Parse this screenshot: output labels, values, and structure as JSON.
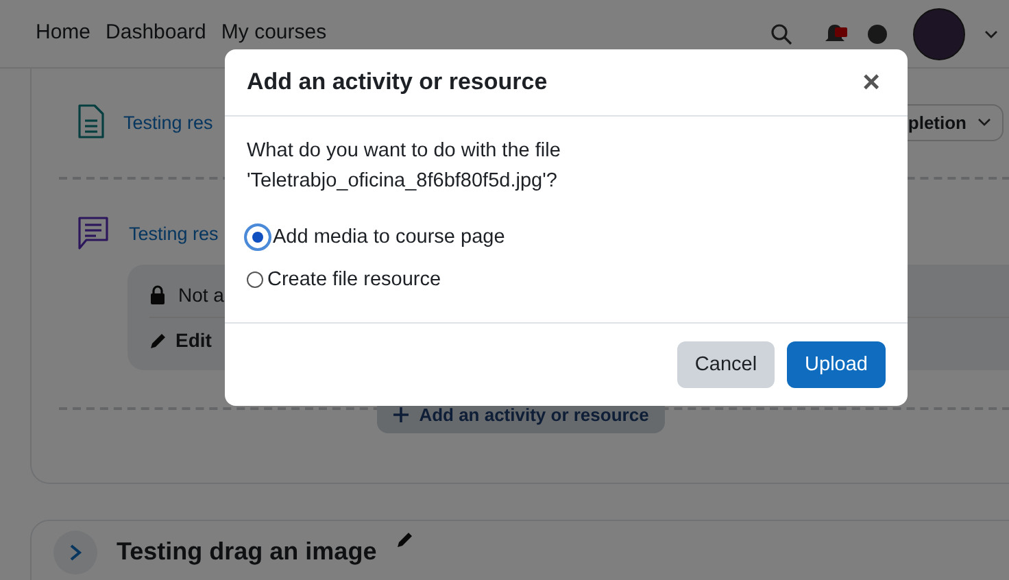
{
  "navbar": {
    "links": [
      "Home",
      "Dashboard",
      "My courses"
    ]
  },
  "course": {
    "activities": [
      {
        "kind": "page",
        "title": "Testing res"
      },
      {
        "kind": "forum",
        "title": "Testing res",
        "restriction": "Not a",
        "edit": "Edit"
      }
    ],
    "completion_button": "pletion",
    "add_button": "Add an activity or resource"
  },
  "next_section": {
    "title": "Testing drag an image"
  },
  "dialog": {
    "title": "Add an activity or resource",
    "close": "×",
    "question": "What do you want to do with the file 'Teletrabjo_oficina_8f6bf80f5d.jpg'?",
    "options": [
      {
        "label": "Add media to course page",
        "selected": true
      },
      {
        "label": "Create file resource",
        "selected": false
      }
    ],
    "buttons": [
      {
        "kind": "secondary",
        "label": "Cancel"
      },
      {
        "kind": "primary",
        "label": "Upload"
      }
    ]
  }
}
